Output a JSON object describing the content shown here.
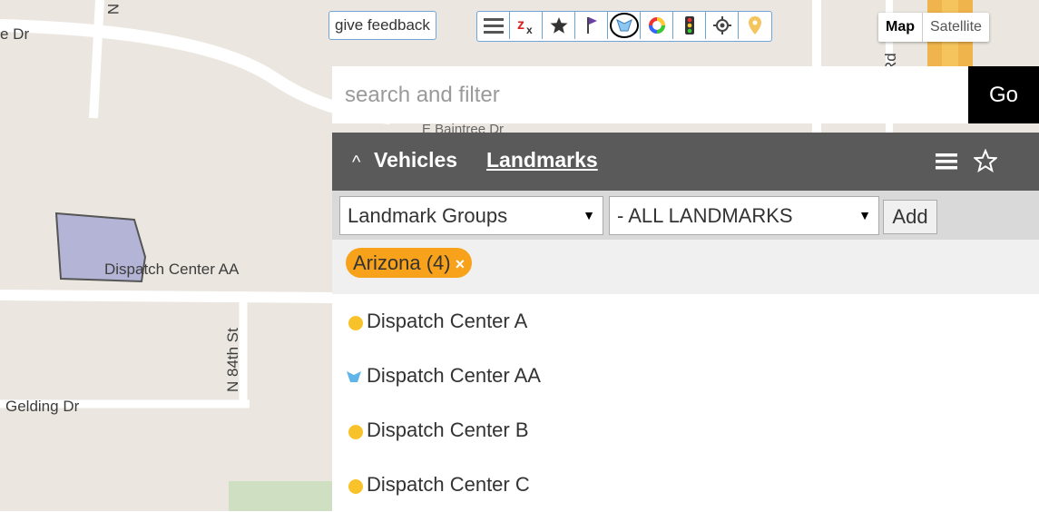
{
  "map": {
    "streets": [
      "e Dr",
      "E Baintree Dr",
      "Dispatch Center AA",
      "N 84th St",
      "Gelding Dr",
      "Rd",
      "N"
    ]
  },
  "toolbar": {
    "feedback_label": "give feedback",
    "tools": [
      "menu-icon",
      "clear-filter-icon",
      "star-icon",
      "flag-icon",
      "landmark-icon",
      "color-wheel-icon",
      "traffic-icon",
      "locate-icon",
      "pin-icon"
    ],
    "map_type": {
      "options": [
        "Map",
        "Satellite"
      ],
      "selected": "Map"
    }
  },
  "search": {
    "placeholder": "search and filter",
    "value": "",
    "go_label": "Go"
  },
  "panel": {
    "collapse_glyph": "^",
    "tabs": {
      "vehicles": "Vehicles",
      "landmarks": "Landmarks",
      "active": "Landmarks"
    },
    "group_select": "Landmark Groups",
    "landmark_select": "- ALL LANDMARKS",
    "add_label": "Add",
    "tag": {
      "label": "Arizona (4)",
      "remove": "×"
    },
    "items": [
      {
        "label": "Dispatch Center A",
        "icon": "circle",
        "color": "#f7c22a"
      },
      {
        "label": "Dispatch Center AA",
        "icon": "polygon-flag",
        "color": "#5fb4e8"
      },
      {
        "label": "Dispatch Center B",
        "icon": "circle",
        "color": "#f7c22a"
      },
      {
        "label": "Dispatch Center C",
        "icon": "circle",
        "color": "#f7c22a"
      }
    ]
  },
  "colors": {
    "map_bg": "#ebe7e0",
    "panel_header": "#5a5a5a",
    "tag": "#f7a21a",
    "landmark_dot": "#f7c22a",
    "polygon_fill": "#b3b4d6"
  }
}
